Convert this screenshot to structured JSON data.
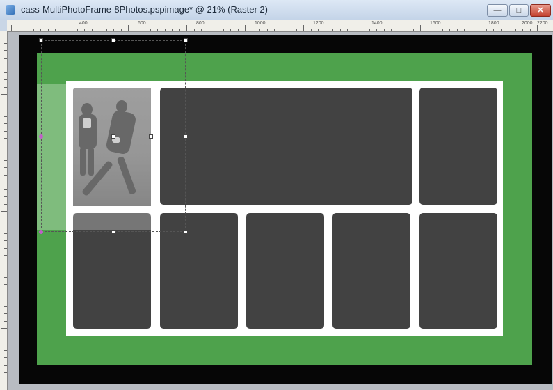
{
  "window": {
    "title": "cass-MultiPhotoFrame-8Photos.pspimage* @  21% (Raster 2)",
    "minimize_glyph": "—",
    "maximize_glyph": "□",
    "close_glyph": "✕"
  },
  "ruler": {
    "labels": [
      "400",
      "600",
      "800",
      "1000",
      "1200",
      "1400",
      "1600",
      "1800",
      "2000",
      "2200"
    ]
  },
  "colors": {
    "frame_border": "#060606",
    "frame_mat": "#4ea24c",
    "frame_inner": "#ffffff",
    "photo_slot": "#424242"
  },
  "layers": {
    "active_layer": "Raster 2"
  }
}
